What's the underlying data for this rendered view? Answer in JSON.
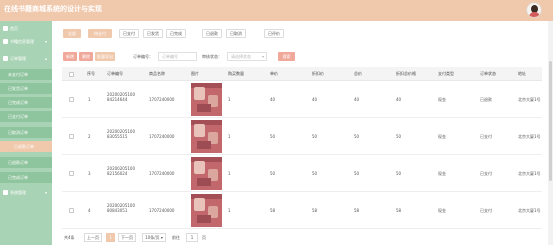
{
  "header": {
    "title": "在线书籍商城系统的设计与实现"
  },
  "sidebar": {
    "items": [
      {
        "label": "首页",
        "type": "top"
      },
      {
        "label": "书籍信息管理",
        "type": "top"
      },
      {
        "label": "订单管理",
        "type": "top"
      },
      {
        "label": "未支付订单",
        "type": "sub"
      },
      {
        "label": "已发货订单",
        "type": "sub"
      },
      {
        "label": "已完成订单",
        "type": "sub"
      },
      {
        "label": "已支付订单",
        "type": "sub"
      },
      {
        "label": "已取消订单",
        "type": "sub"
      },
      {
        "label": "已退款订单",
        "type": "active"
      },
      {
        "label": "已退款订单",
        "type": "sub"
      },
      {
        "label": "已完成订单",
        "type": "sub"
      },
      {
        "label": "系统管理",
        "type": "top"
      }
    ]
  },
  "tabs": [
    "全部",
    "待支付",
    "已支付",
    "已发货",
    "已完成",
    "已退款",
    "已取消",
    "已评价"
  ],
  "toolbar": {
    "add": "新增",
    "delete": "删除",
    "export": "批量导出",
    "order_no_label": "订单编号：",
    "order_no_placeholder": "订单编号",
    "status_label": "审核状态：",
    "status_placeholder": "请选择状态",
    "search": "搜索"
  },
  "table": {
    "headers": [
      "序号",
      "订单编号",
      "商品名称",
      "图片",
      "购买数量",
      "单价",
      "折扣价",
      "总价",
      "折扣总价格",
      "支付类型",
      "订单状态",
      "地址"
    ],
    "rows": [
      {
        "idx": "1",
        "order": "2020020510084214644",
        "product": "1707240000",
        "qty": "1",
        "price": "40",
        "disc": "40",
        "total": "40",
        "disc_total": "40",
        "pay": "现金",
        "status": "已退款",
        "addr": "北京大厦1号"
      },
      {
        "idx": "2",
        "order": "2020020510083055515",
        "product": "1707240000",
        "qty": "1",
        "price": "50",
        "disc": "50",
        "total": "50",
        "disc_total": "50",
        "pay": "现金",
        "status": "已支付",
        "addr": "北京大厦1号"
      },
      {
        "idx": "3",
        "order": "2020020510082156024",
        "product": "1707240000",
        "qty": "1",
        "price": "50",
        "disc": "50",
        "total": "50",
        "disc_total": "50",
        "pay": "现金",
        "status": "已支付",
        "addr": "北京大厦1号"
      },
      {
        "idx": "4",
        "order": "2020020510080843051",
        "product": "1707240000",
        "qty": "1",
        "price": "58",
        "disc": "58",
        "total": "58",
        "disc_total": "58",
        "pay": "现金",
        "status": "已支付",
        "addr": "北京大厦1号"
      }
    ]
  },
  "pagination": {
    "total": "共4条",
    "prev": "上一页",
    "current": "1",
    "next": "下一页",
    "size": "10条/页",
    "goto": "前往",
    "page_input": "1",
    "page_unit": "页"
  },
  "colors": {
    "header": "#f0c8ac",
    "sidebar": "#a9d3b5",
    "accent": "#f0a89a"
  }
}
